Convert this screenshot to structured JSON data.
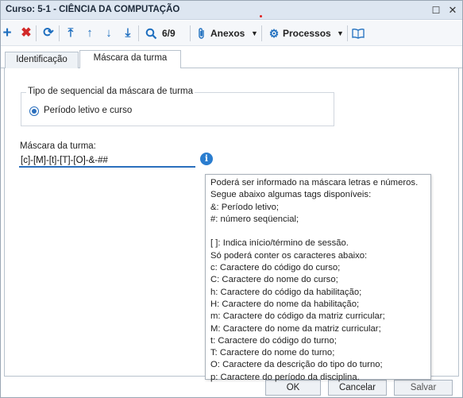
{
  "window": {
    "title": "Curso: 5-1 - CIÊNCIA DA COMPUTAÇÃO",
    "restore_glyph": "☐",
    "close_glyph": "✕"
  },
  "toolbar": {
    "add_glyph": "+",
    "delete_glyph": "✖",
    "refresh_glyph": "⟳",
    "first_glyph": "⤒",
    "prev_glyph": "↑",
    "next_glyph": "↓",
    "last_glyph": "⤓",
    "search_glyph": "⚲",
    "record_counter": "6/9",
    "attach_glyph": "⚲",
    "attachments_label": "Anexos",
    "attachments_caret": "▼",
    "processes_glyph": "⚙",
    "processes_label": "Processos",
    "processes_caret": "▼",
    "book_glyph": "▯"
  },
  "tabs": [
    {
      "label": "Identificação",
      "active": false
    },
    {
      "label": "Máscara da turma",
      "active": true
    }
  ],
  "sequence_group": {
    "legend": "Tipo de sequencial da máscara de turma",
    "option_label": "Período letivo e curso",
    "selected": true
  },
  "mask": {
    "label": "Máscara da turma:",
    "value": "[c]-[M]-[t]-[T]-[O]-&-##",
    "info_glyph": "i"
  },
  "tooltip_lines": [
    "Poderá ser informado na máscara letras e números.",
    "Segue abaixo algumas tags disponíveis:",
    "&: Período letivo;",
    "#: número seqüencial;",
    "",
    "[ ]: Indica início/término de sessão.",
    "Só poderá conter os caracteres abaixo:",
    "c: Caractere do código do curso;",
    "C: Caractere do nome do curso;",
    "h: Caractere do código da habilitação;",
    "H: Caractere do nome da habilitação;",
    "m: Caractere do código da matriz curricular;",
    "M: Caractere do nome da matriz curricular;",
    "t: Caractere do código do turno;",
    "T: Caractere do nome do turno;",
    "O: Caractere da descrição do tipo do turno;",
    "p: Caractere do período da disciplina."
  ],
  "footer": {
    "ok_label": "OK",
    "cancel_label": "Cancelar",
    "save_label": "Salvar"
  },
  "colors": {
    "accent": "#2a6fbd",
    "delete": "#d22a2a",
    "titlebar": "#dde6f1"
  }
}
